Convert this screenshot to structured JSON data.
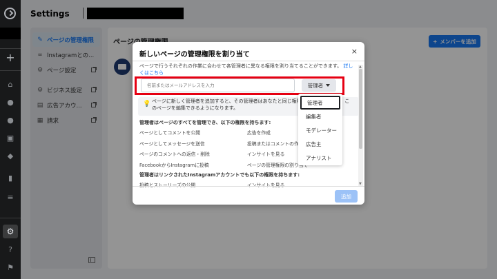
{
  "header": {
    "title": "Settings"
  },
  "sidebar": {
    "items": [
      {
        "label": "ページの管理権限",
        "icon": "key-icon"
      },
      {
        "label": "Instagramとの...",
        "icon": "link-icon"
      },
      {
        "label": "ページ設定",
        "icon": "gear-icon"
      },
      {
        "label": "ビジネス設定",
        "icon": "gear-icon"
      },
      {
        "label": "広告アカウ...",
        "icon": "ad-icon"
      },
      {
        "label": "請求",
        "icon": "receipt-icon"
      }
    ]
  },
  "main": {
    "heading": "ページの管理権限",
    "add_member_label": "メンバーを追加"
  },
  "dialog": {
    "title": "新しいページの管理権限を割り当て",
    "close_glyph": "×",
    "description": "ページで行うそれぞれの作業に合わせて各管理者に異なる権限を割り当てることができます。",
    "learn_more": "詳しくはこちら",
    "input_placeholder": "名前またはメールアドレスを入力",
    "role_selected": "管理者",
    "info_text": "ページに新しく管理者を追加すると、その管理者はあなたと同じ権限を持つことになり、このページを編集できるようになります。",
    "perm_heading_1": "管理者はページのすべてを管理でき、以下の権限を持ちます:",
    "perms_1": [
      [
        "ページとしてコメントを公開",
        "広告を作成"
      ],
      [
        "ページとしてメッセージを送信",
        "投稿またはコメントの作成"
      ],
      [
        "ページのコメントへの返信・削除",
        "インサイトを見る"
      ],
      [
        "FacebookからInstagramに投稿",
        "ページの管理権限の割り当て"
      ]
    ],
    "perm_heading_2": "管理者はリンクされたInstagramアカウントでも以下の権限を持ちます:",
    "perms_2": [
      [
        "投稿とストーリーズの公開",
        "インサイトを見る"
      ]
    ],
    "add_label": "追加"
  },
  "role_dropdown": {
    "options": [
      "管理者",
      "編集者",
      "モデレーター",
      "広告主",
      "アナリスト"
    ],
    "selected": "管理者"
  }
}
